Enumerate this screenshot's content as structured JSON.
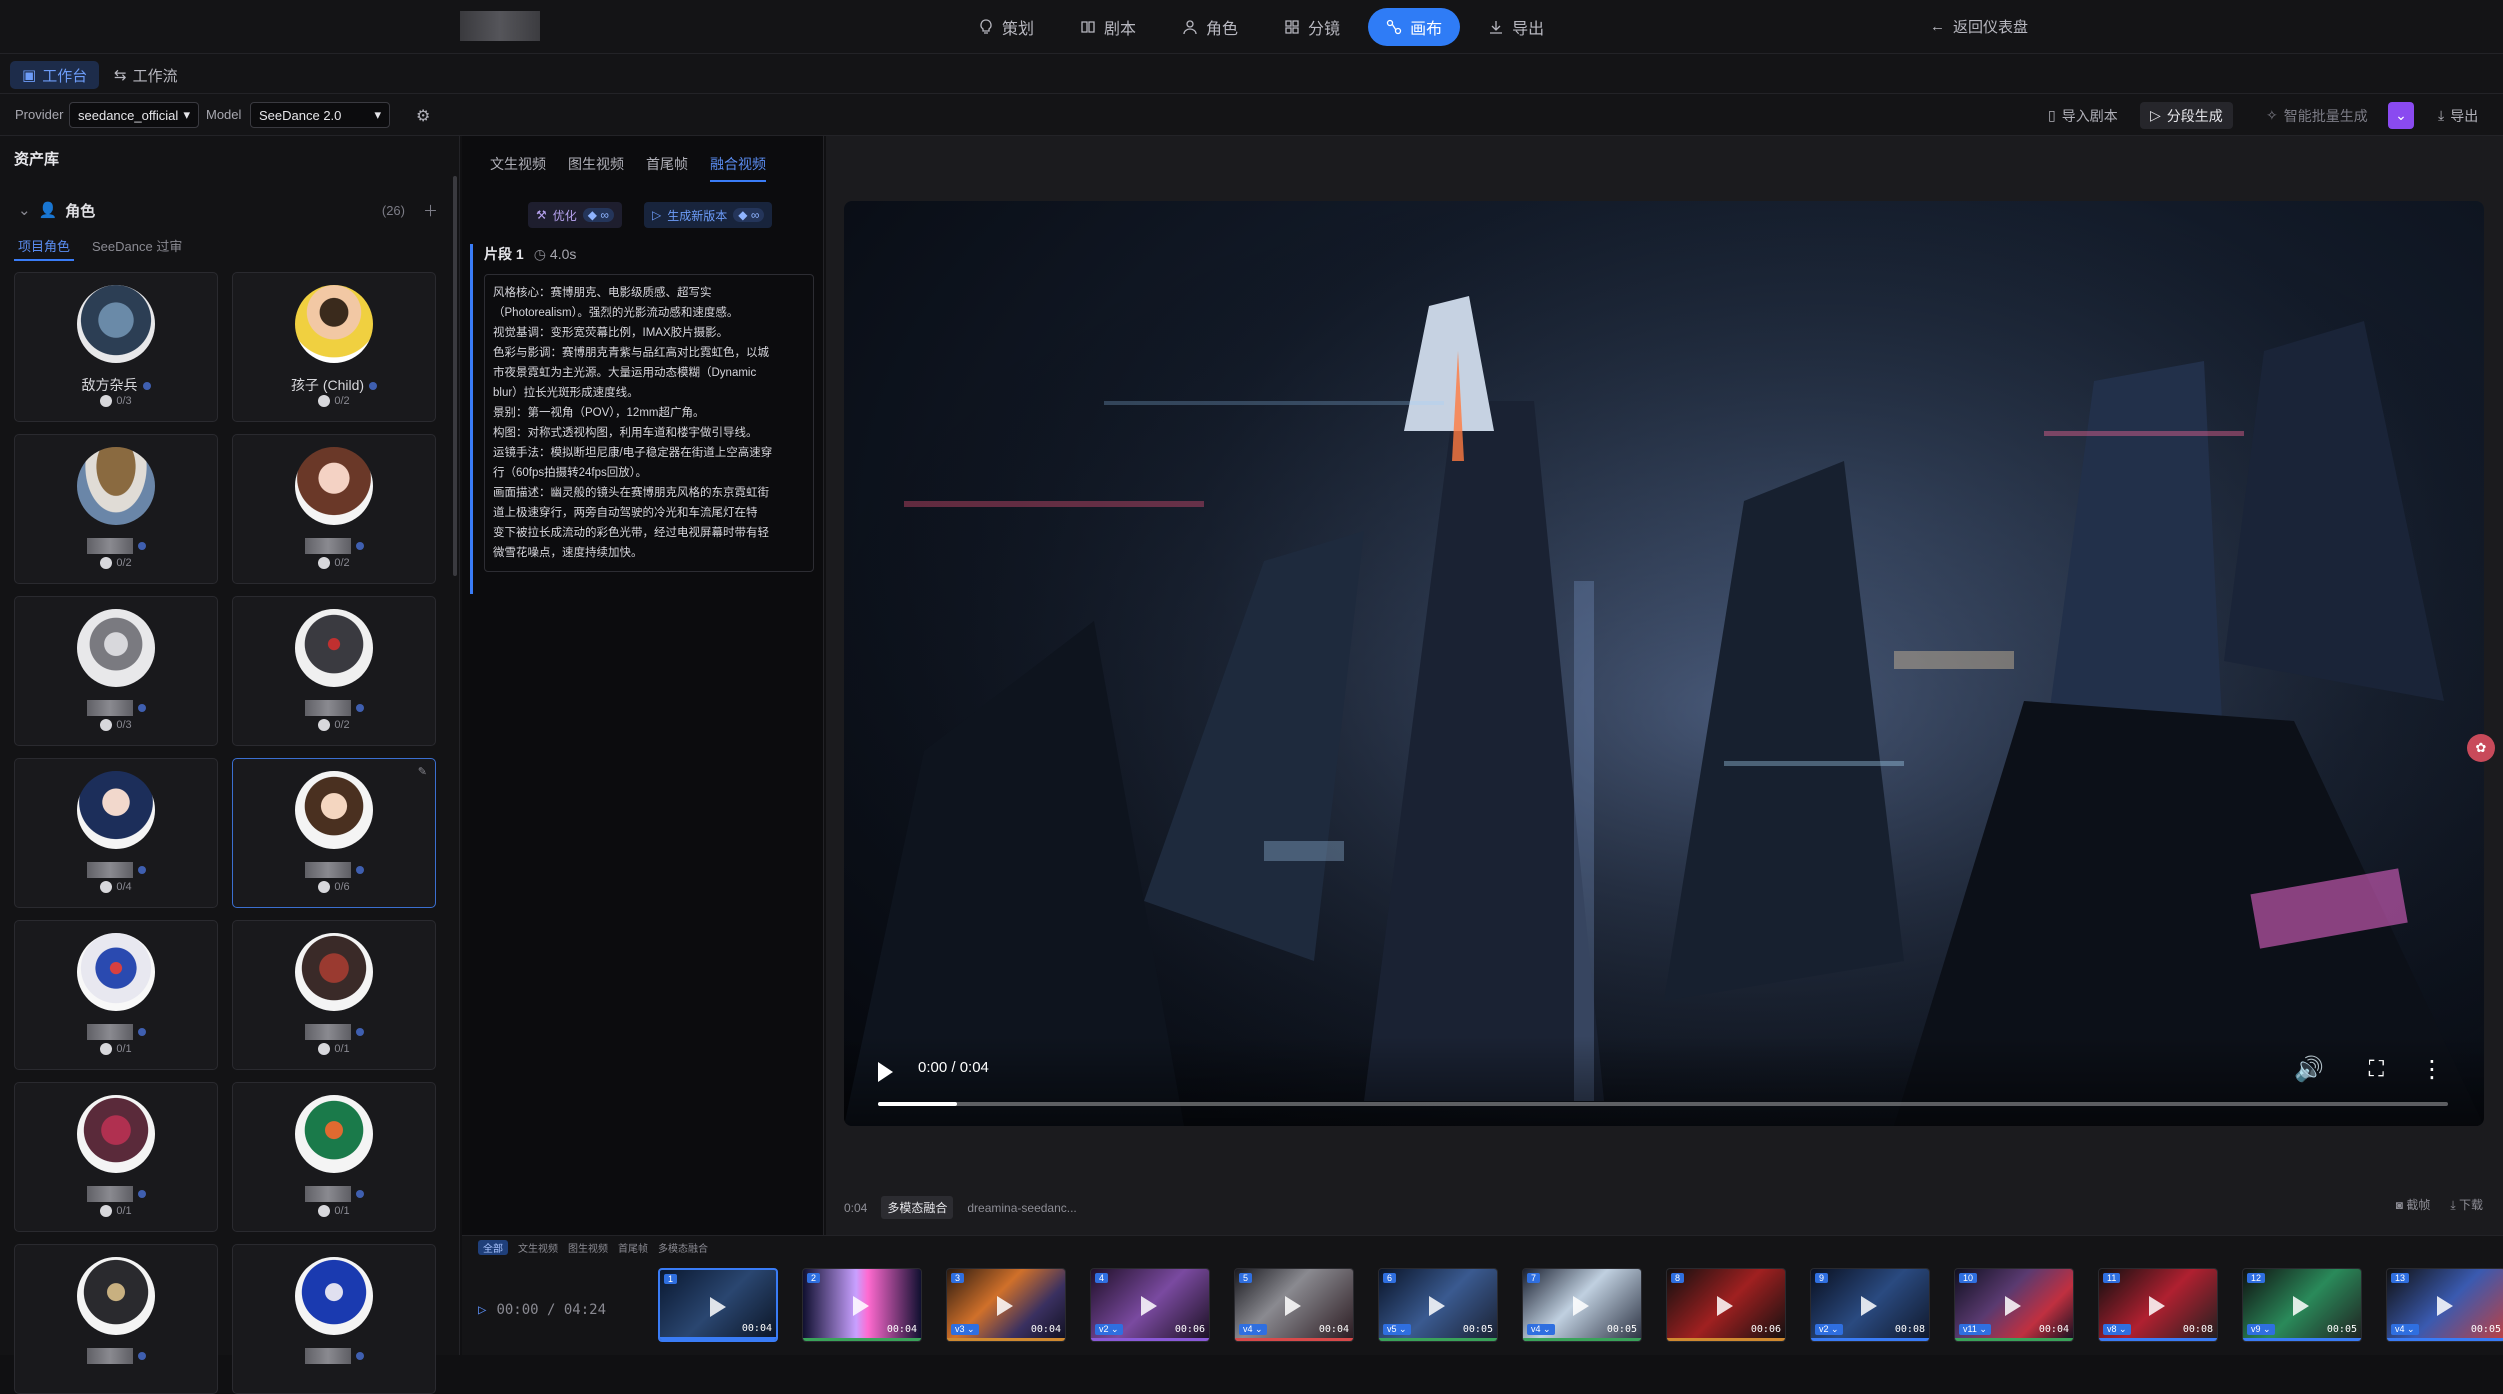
{
  "nav": {
    "items": [
      {
        "label": "策划",
        "icon": "lightbulb-icon"
      },
      {
        "label": "剧本",
        "icon": "book-icon"
      },
      {
        "label": "角色",
        "icon": "user-icon"
      },
      {
        "label": "分镜",
        "icon": "grid-icon"
      },
      {
        "label": "画布",
        "icon": "canvas-icon",
        "active": true
      },
      {
        "label": "导出",
        "icon": "download-icon"
      }
    ],
    "back_label": "返回仪表盘"
  },
  "subnav": {
    "workbench": "工作台",
    "workflow": "工作流"
  },
  "toolbar": {
    "provider_label": "Provider",
    "provider_value": "seedance_official",
    "model_label": "Model",
    "model_value": "SeeDance 2.0",
    "import_script": "导入剧本",
    "segment_generate": "分段生成",
    "smart_batch": "智能批量生成",
    "export": "导出"
  },
  "assets": {
    "title": "资产库",
    "section_label": "角色",
    "count": "(26)",
    "tab_project": "项目角色",
    "tab_seedance": "SeeDance 过审",
    "cards": [
      {
        "name": "敌方杂兵",
        "count": "0/3",
        "av": "soldier"
      },
      {
        "name": "孩子 (Child)",
        "count": "0/2",
        "av": "child"
      },
      {
        "name": "",
        "count": "0/2",
        "av": "hat"
      },
      {
        "name": "",
        "count": "0/2",
        "av": "girl"
      },
      {
        "name": "",
        "count": "0/3",
        "av": "tiger"
      },
      {
        "name": "",
        "count": "0/2",
        "av": "demon"
      },
      {
        "name": "",
        "count": "0/4",
        "av": "bluehair"
      },
      {
        "name": "",
        "count": "0/6",
        "av": "boy",
        "selected": true
      },
      {
        "name": "",
        "count": "0/1",
        "av": "mecha"
      },
      {
        "name": "",
        "count": "0/1",
        "av": "armor"
      },
      {
        "name": "",
        "count": "0/1",
        "av": "redmecha"
      },
      {
        "name": "",
        "count": "0/1",
        "av": "greenmecha"
      },
      {
        "name": "",
        "count": "",
        "av": "xwarrior"
      },
      {
        "name": "",
        "count": "",
        "av": "bluewarrior"
      }
    ]
  },
  "editor": {
    "tabs": [
      "文生视频",
      "图生视频",
      "首尾帧",
      "融合视频"
    ],
    "active_tab": "融合视频",
    "optimize": "优化",
    "generate_new": "生成新版本",
    "infinity": "∞",
    "segment_title": "片段 1",
    "segment_duration": "4.0s",
    "prompt_lines": [
      "风格核心：赛博朋克、电影级质感、超写实",
      "（Photorealism）。强烈的光影流动感和速度感。",
      "视觉基调：变形宽荧幕比例，IMAX胶片摄影。",
      "色彩与影调：赛博朋克青紫与品红高对比霓虹色，以城",
      "市夜景霓虹为主光源。大量运用动态模糊（Dynamic",
      "blur）拉长光斑形成速度线。",
      "景别：第一视角（POV），12mm超广角。",
      "构图：对称式透视构图，利用车道和楼宇做引导线。",
      "运镜手法：模拟断坦尼康/电子稳定器在街道上空高速穿",
      "行（60fps拍摄转24fps回放）。",
      "画面描述：幽灵般的镜头在赛博朋克风格的东京霓虹街",
      "道上极速穿行，两旁自动驾驶的冷光和车流尾灯在特",
      "变下被拉长成流动的彩色光带，经过电视屏幕时带有轻",
      "微雪花噪点，速度持续加快。"
    ]
  },
  "player": {
    "time": "0:00 / 0:04",
    "progress": 0.05,
    "info_time": "0:04",
    "info_tag": "多模态融合",
    "info_model": "dreamina-seedanc...",
    "screenshot": "截帧",
    "download": "下载"
  },
  "timeline": {
    "filters": [
      "全部",
      "文生视频",
      "图生视频",
      "首尾帧",
      "多模态融合"
    ],
    "timecode": "00:00 / 04:24",
    "clips": [
      {
        "num": "1",
        "ver": "",
        "dur": "00:04",
        "line": "#3a7cf6",
        "bg": "city"
      },
      {
        "num": "2",
        "ver": "",
        "dur": "00:04",
        "line": "#3aa35a",
        "bg": "tunnel"
      },
      {
        "num": "3",
        "ver": "v3",
        "dur": "00:04",
        "line": "#d08a30",
        "bg": "street"
      },
      {
        "num": "4",
        "ver": "v2",
        "dur": "00:06",
        "line": "#8a5ad8",
        "bg": "purple"
      },
      {
        "num": "5",
        "ver": "v4",
        "dur": "00:04",
        "line": "#d84a4a",
        "bg": "fight"
      },
      {
        "num": "6",
        "ver": "v5",
        "dur": "00:05",
        "line": "#3aa35a",
        "bg": "city2"
      },
      {
        "num": "7",
        "ver": "v4",
        "dur": "00:05",
        "line": "#3aa35a",
        "bg": "ice"
      },
      {
        "num": "8",
        "ver": "",
        "dur": "00:06",
        "line": "#d08a30",
        "bg": "red"
      },
      {
        "num": "9",
        "ver": "v2",
        "dur": "00:08",
        "line": "#3a7cf6",
        "bg": "city3"
      },
      {
        "num": "10",
        "ver": "v11",
        "dur": "00:04",
        "line": "#3aa35a",
        "bg": "street2"
      },
      {
        "num": "11",
        "ver": "v8",
        "dur": "00:08",
        "line": "#3a7cf6",
        "bg": "hero"
      },
      {
        "num": "12",
        "ver": "v9",
        "dur": "00:05",
        "line": "#3a7cf6",
        "bg": "hero2"
      },
      {
        "num": "13",
        "ver": "v4",
        "dur": "00:05",
        "line": "#3a7cf6",
        "bg": "hero3"
      }
    ]
  }
}
